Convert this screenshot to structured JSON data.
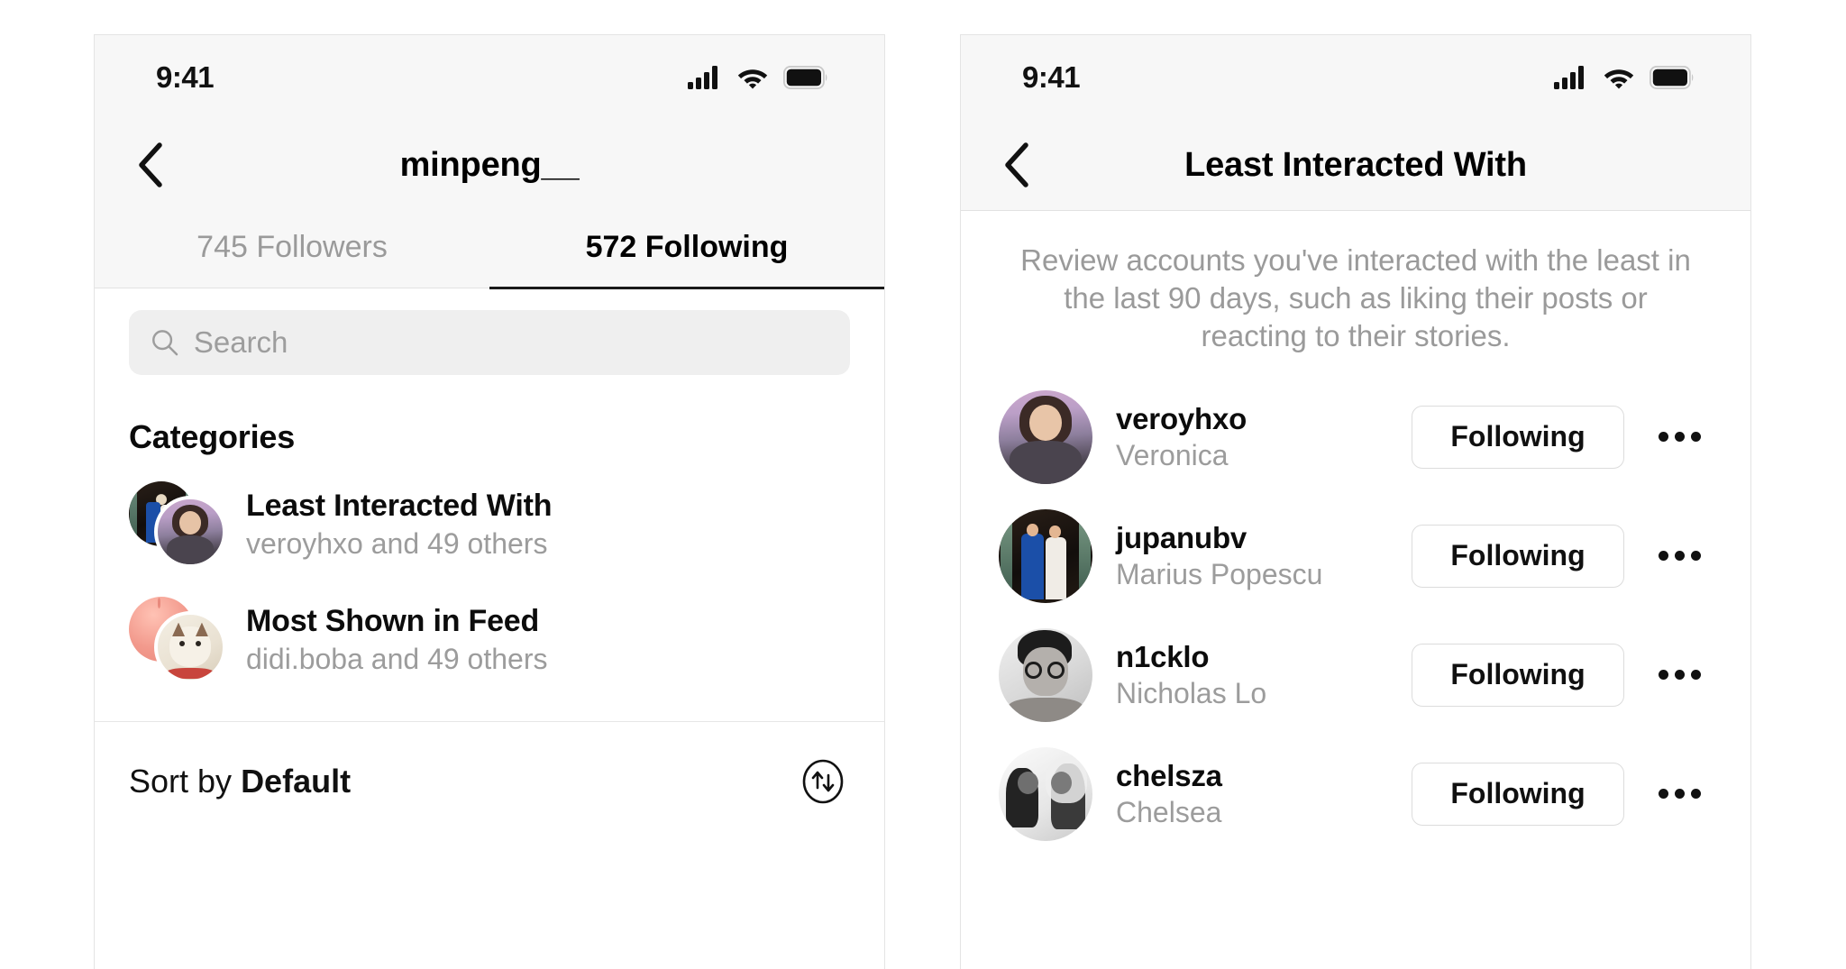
{
  "status_bar": {
    "time": "9:41",
    "icons": [
      "cellular-signal-icon",
      "wifi-icon",
      "battery-icon"
    ]
  },
  "left_panel": {
    "nav": {
      "back_icon": "chevron-left-icon",
      "title": "minpeng__"
    },
    "tabs": [
      {
        "label": "745 Followers",
        "active": false
      },
      {
        "label": "572 Following",
        "active": true
      }
    ],
    "search": {
      "icon": "search-icon",
      "placeholder": "Search",
      "value": ""
    },
    "categories_heading": "Categories",
    "categories": [
      {
        "title": "Least Interacted With",
        "subtitle": "veroyhxo and 49 others",
        "avatar_back": "wedding-couple-photo",
        "avatar_front": "veronica-portrait-photo"
      },
      {
        "title": "Most Shown in Feed",
        "subtitle": "didi.boba and 49 others",
        "avatar_back": "pink-balloon-photo",
        "avatar_front": "cat-photo"
      }
    ],
    "sort": {
      "prefix": "Sort by ",
      "value": "Default",
      "icon": "sort-arrows-icon"
    }
  },
  "right_panel": {
    "nav": {
      "back_icon": "chevron-left-icon",
      "title": "Least Interacted With"
    },
    "description": "Review accounts you've interacted with the least in the last 90 days, such as liking their posts or reacting to their stories.",
    "users": [
      {
        "username": "veroyhxo",
        "fullname": "Veronica",
        "button": "Following",
        "more_icon": "ellipsis-icon",
        "avatar": "veronica-portrait-photo"
      },
      {
        "username": "jupanubv",
        "fullname": "Marius Popescu",
        "button": "Following",
        "more_icon": "ellipsis-icon",
        "avatar": "wedding-couple-photo"
      },
      {
        "username": "n1cklo",
        "fullname": "Nicholas Lo",
        "button": "Following",
        "more_icon": "ellipsis-icon",
        "avatar": "man-glasses-photo"
      },
      {
        "username": "chelsza",
        "fullname": "Chelsea",
        "button": "Following",
        "more_icon": "ellipsis-icon",
        "avatar": "wedding-kiss-photo"
      }
    ]
  },
  "colors": {
    "accent": "#000000",
    "muted": "#9a9a9a",
    "chrome": "#f7f7f7",
    "border": "#e2e2e2"
  }
}
